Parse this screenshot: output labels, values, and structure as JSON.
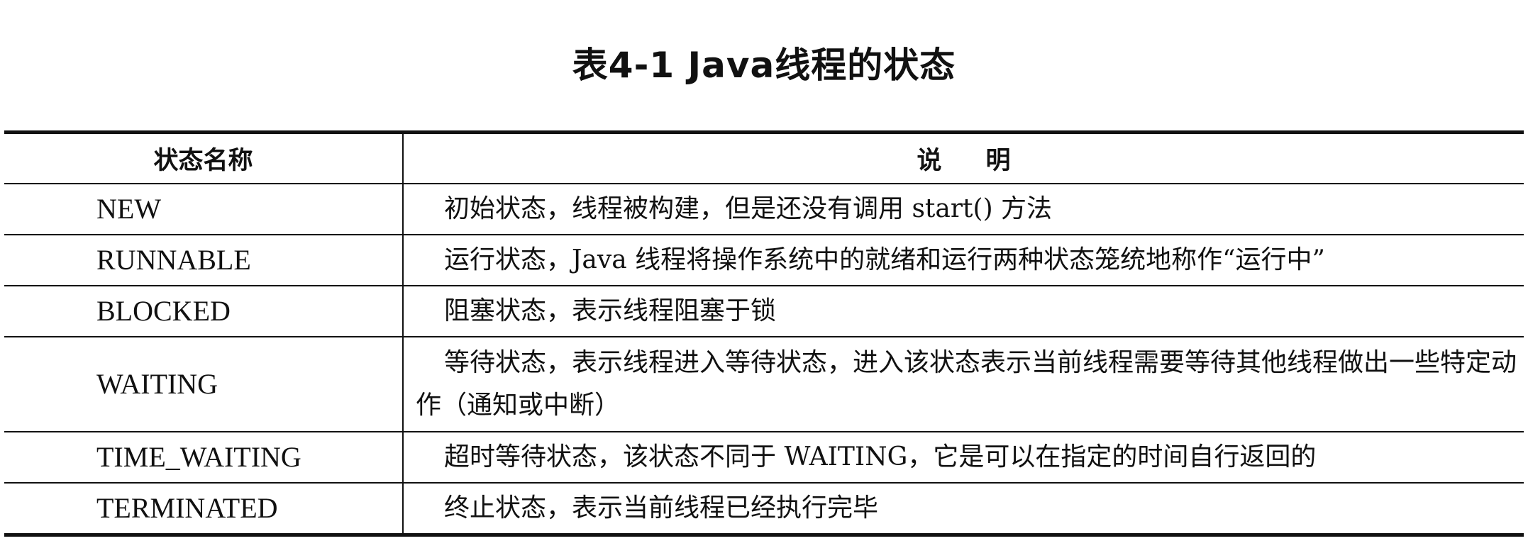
{
  "caption": "表4-1   Java线程的状态",
  "table": {
    "headers": [
      "状态名称",
      "说明"
    ],
    "rows": [
      {
        "name": "NEW",
        "desc": "初始状态，线程被构建，但是还没有调用 start() 方法"
      },
      {
        "name": "RUNNABLE",
        "desc": "运行状态，Java 线程将操作系统中的就绪和运行两种状态笼统地称作“运行中”"
      },
      {
        "name": "BLOCKED",
        "desc": "阻塞状态，表示线程阻塞于锁"
      },
      {
        "name": "WAITING",
        "desc": "等待状态，表示线程进入等待状态，进入该状态表示当前线程需要等待其他线程做出一些特定动作（通知或中断）"
      },
      {
        "name": "TIME_WAITING",
        "desc": "超时等待状态，该状态不同于 WAITING，它是可以在指定的时间自行返回的"
      },
      {
        "name": "TERMINATED",
        "desc": "终止状态，表示当前线程已经执行完毕"
      }
    ]
  }
}
